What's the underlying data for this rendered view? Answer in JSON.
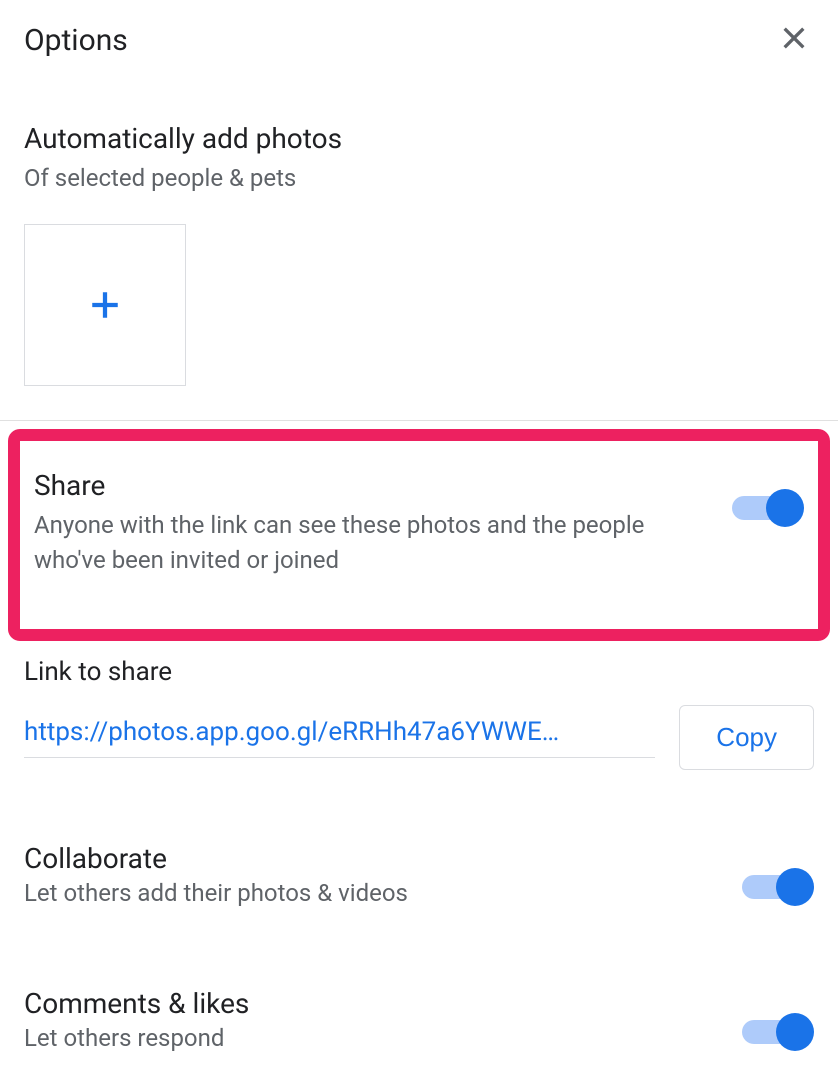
{
  "header": {
    "title": "Options"
  },
  "auto_add": {
    "title": "Automatically add photos",
    "subtitle": "Of selected people & pets"
  },
  "share": {
    "title": "Share",
    "subtitle": "Anyone with the link can see these photos and the people who've been invited or joined",
    "enabled": true
  },
  "link": {
    "label": "Link to share",
    "url": "https://photos.app.goo.gl/eRRHh47a6YWWE…",
    "copy_label": "Copy"
  },
  "collaborate": {
    "title": "Collaborate",
    "subtitle": "Let others add their photos & videos",
    "enabled": true
  },
  "comments": {
    "title": "Comments & likes",
    "subtitle": "Let others respond",
    "enabled": true
  }
}
